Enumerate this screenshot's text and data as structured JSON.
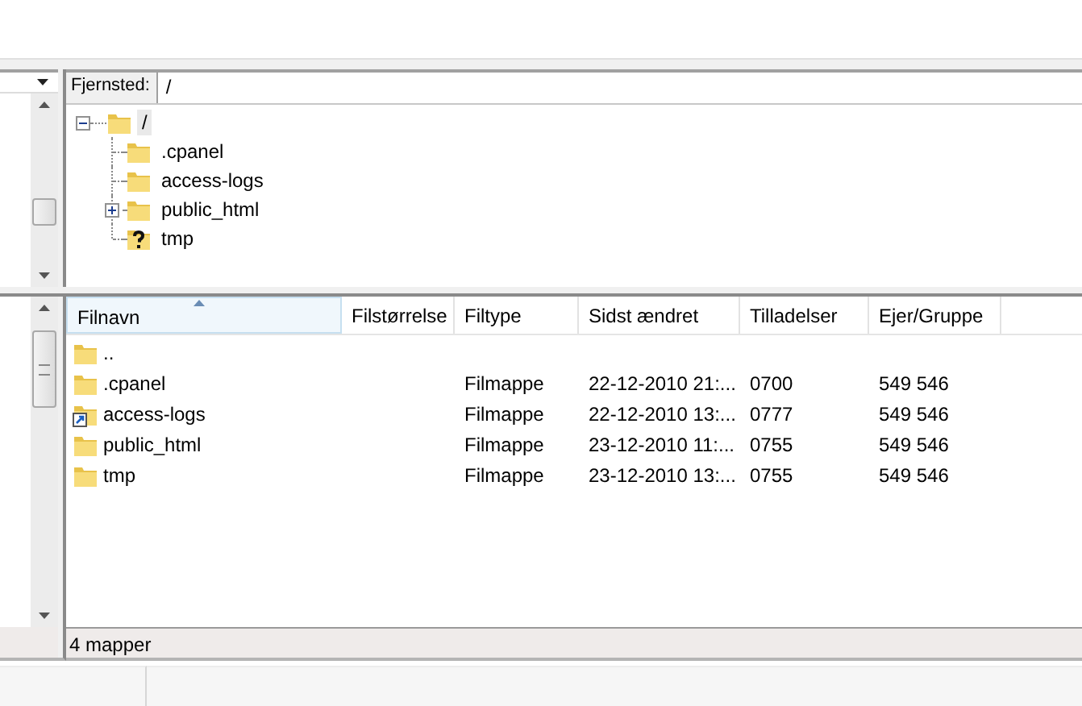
{
  "remote_site": {
    "label": "Fjernsted:",
    "value": "/"
  },
  "tree": {
    "label": "/",
    "expanded": true,
    "selected": true,
    "children": [
      {
        "label": ".cpanel",
        "kind": "folder",
        "has_children": false
      },
      {
        "label": "access-logs",
        "kind": "folder",
        "has_children": false
      },
      {
        "label": "public_html",
        "kind": "folder",
        "has_children": true
      },
      {
        "label": "tmp",
        "kind": "unknown",
        "has_children": false
      }
    ]
  },
  "table": {
    "columns": [
      {
        "label": "Filnavn",
        "sorted": true
      },
      {
        "label": "Filstørrelse",
        "sorted": false
      },
      {
        "label": "Filtype",
        "sorted": false
      },
      {
        "label": "Sidst ændret",
        "sorted": false
      },
      {
        "label": "Tilladelser",
        "sorted": false
      },
      {
        "label": "Ejer/Gruppe",
        "sorted": false
      }
    ],
    "rows": [
      {
        "kind": "folder",
        "cells": [
          "..",
          "",
          "",
          "",
          "",
          ""
        ]
      },
      {
        "kind": "folder",
        "cells": [
          ".cpanel",
          "",
          "Filmappe",
          "22-12-2010 21:...",
          "0700",
          "549 546"
        ]
      },
      {
        "kind": "symlink",
        "cells": [
          "access-logs",
          "",
          "Filmappe",
          "22-12-2010 13:...",
          "0777",
          "549 546"
        ]
      },
      {
        "kind": "folder",
        "cells": [
          "public_html",
          "",
          "Filmappe",
          "23-12-2010 11:...",
          "0755",
          "549 546"
        ]
      },
      {
        "kind": "folder",
        "cells": [
          "tmp",
          "",
          "Filmappe",
          "23-12-2010 13:...",
          "0755",
          "549 546"
        ]
      }
    ]
  },
  "status_bar": {
    "text": "4 mapper"
  }
}
